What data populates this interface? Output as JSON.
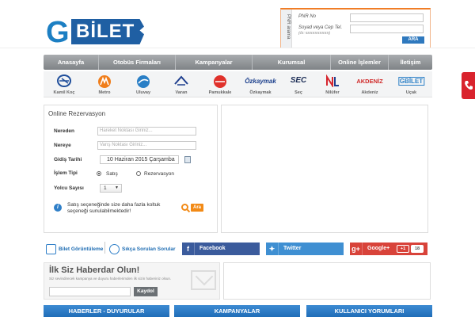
{
  "header": {
    "logo_g": "G",
    "logo_word": "BİLET",
    "pnr": {
      "side_label": "PNR arama",
      "pnr_label": "PNR No",
      "phone_label": "Soyad veya Cep Tel.",
      "phone_hint": "(Ör: 5XXXXXXXXX)",
      "button": "ARA"
    }
  },
  "nav": {
    "items": [
      "Anasayfa",
      "Otobüs Firmaları",
      "Kampanyalar",
      "Kurumsal",
      "Online İşlemler",
      "İletişim"
    ]
  },
  "brands": {
    "items": [
      {
        "name": "Kamil Koç",
        "icon": "kamilkoc-logo-icon",
        "color": "#1f4e9b"
      },
      {
        "name": "Metro",
        "icon": "metro-logo-icon",
        "color": "#f07d1a"
      },
      {
        "name": "Uluvay",
        "icon": "uluvay-logo-icon",
        "color": "#2a7fc6"
      },
      {
        "name": "Varan",
        "icon": "varan-logo-icon",
        "color": "#1f3f8f"
      },
      {
        "name": "Pamukkale",
        "icon": "pamukkale-logo-icon",
        "color": "#e0312b"
      },
      {
        "name": "Özkaymak",
        "icon": "ozkaymak-logo-icon",
        "color": "#1b3f8c",
        "logo_text": "Özkaymak"
      },
      {
        "name": "Seç",
        "icon": "sec-logo-icon",
        "color": "#1b2c55",
        "logo_text": "SEC"
      },
      {
        "name": "Nilüfer",
        "icon": "nilufer-logo-icon",
        "color": "#d6262e"
      },
      {
        "name": "Akdeniz",
        "icon": "akdeniz-logo-icon",
        "color": "#d02a2a",
        "logo_text": "AKDENİZ"
      },
      {
        "name": "Uçak",
        "icon": "ucak-logo-icon",
        "color": "#2a7fc6",
        "logo_text": "GBİLET"
      }
    ]
  },
  "form": {
    "title": "Online Rezervasyon",
    "from_label": "Nereden",
    "from_placeholder": "Hareket Noktası Giriniz...",
    "to_label": "Nereye",
    "to_placeholder": "Varış Noktası Giriniz...",
    "date_label": "Gidiş Tarihi",
    "date_value": "10 Haziran 2015 Çarşamba",
    "type_label": "İşlem Tipi",
    "type_sale": "Satış",
    "type_reservation": "Rezervasyon",
    "type_selected": "Satış",
    "count_label": "Yolcu Sayısı",
    "count_value": "1",
    "info_text": "Satış seçeneğinde size daha fazla koltuk seçeneği sunulabilmektedir!",
    "search_button": "Ara"
  },
  "strip": {
    "view_ticket": "Bilet Görüntüleme",
    "faq": "Sıkça Sorulan Sorular",
    "facebook": "Facebook",
    "twitter": "Twitter",
    "google": "Google+",
    "google_badge": "+1",
    "google_count": "18"
  },
  "newsletter": {
    "title": "İlk Siz Haberdar Olun!",
    "subtitle": "Siz sevindirecek kampanya ve duyuru haberlerimden ilk sizin haberiniz olsun.",
    "button": "Kaydol"
  },
  "bottom_headers": [
    "HABERLER - DUYURULAR",
    "KAMPANYALAR",
    "KULLANICI YORUMLARI"
  ],
  "colors": {
    "primary_blue": "#1f6db8",
    "accent_orange": "#f28a16",
    "nav_gray": "#8f9396",
    "call_red": "#d9232d"
  }
}
